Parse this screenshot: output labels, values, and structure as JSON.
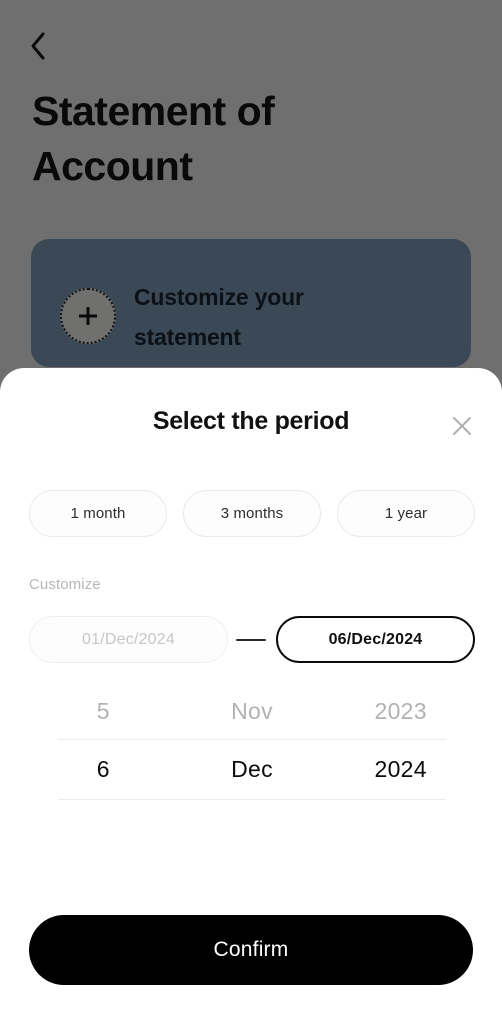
{
  "background_page": {
    "back_icon": "chevron-left-icon",
    "title": "Statement of Account",
    "customize_card": {
      "icon": "plus-icon",
      "label": "Customize your statement",
      "background_color": "#536476"
    },
    "overlay_color": "#747474"
  },
  "sheet": {
    "title": "Select the period",
    "close_icon": "close-icon",
    "presets": [
      {
        "label": "1 month",
        "selected": false
      },
      {
        "label": "3 months",
        "selected": false
      },
      {
        "label": "1 year",
        "selected": false
      }
    ],
    "customize_label": "Customize",
    "date_range": {
      "start": {
        "value": "01/Dec/2024",
        "active": false
      },
      "separator": "—",
      "end": {
        "value": "06/Dec/2024",
        "active": true
      }
    },
    "picker": {
      "columns": [
        "day",
        "month",
        "year"
      ],
      "rows": [
        {
          "state": "above",
          "day": "5",
          "month": "Nov",
          "year": "2023"
        },
        {
          "state": "selected",
          "day": "6",
          "month": "Dec",
          "year": "2024"
        }
      ]
    },
    "confirm_label": "Confirm",
    "accent_color": "#000000"
  }
}
